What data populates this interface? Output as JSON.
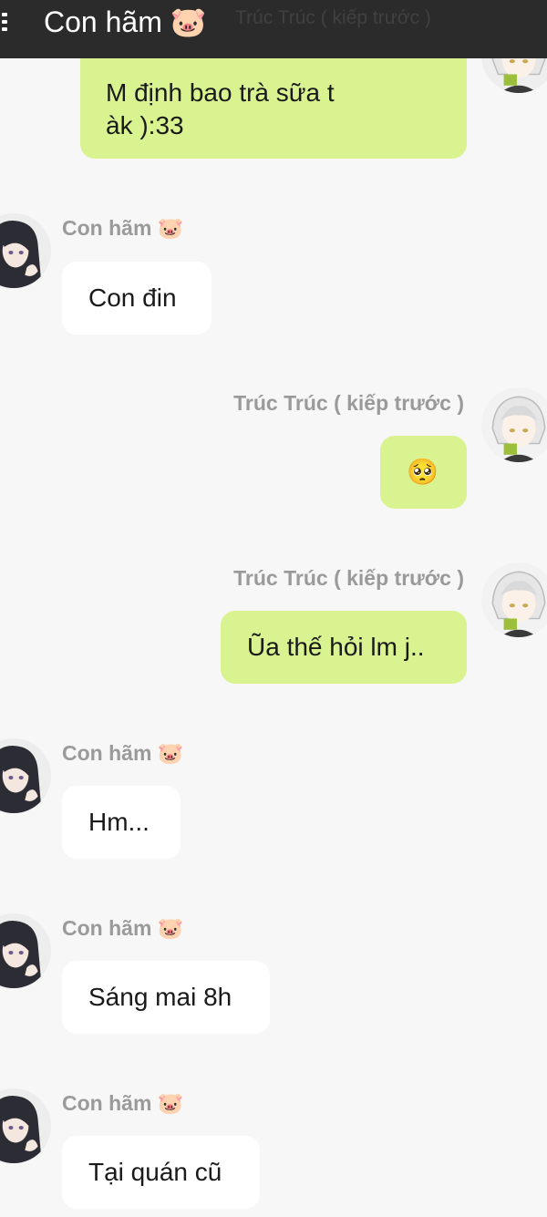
{
  "header": {
    "title": "Con hãm 🐷",
    "ghost_text": "Trúc Trúc ( kiếp trước )"
  },
  "messages": [
    {
      "side": "right",
      "sender": "",
      "text": "M định bao trà sữa t\nàk ):33"
    },
    {
      "side": "left",
      "sender": "Con hãm 🐷",
      "text": "Con đin"
    },
    {
      "side": "right",
      "sender": "Trúc Trúc ( kiếp trước )",
      "text": "🥺"
    },
    {
      "side": "right",
      "sender": "Trúc Trúc ( kiếp trước )",
      "text": "Ũa thế hỏi lm j.."
    },
    {
      "side": "left",
      "sender": "Con hãm 🐷",
      "text": "Hm..."
    },
    {
      "side": "left",
      "sender": "Con hãm 🐷",
      "text": "Sáng mai 8h"
    },
    {
      "side": "left",
      "sender": "Con hãm 🐷",
      "text": "Tại quán cũ"
    }
  ],
  "colors": {
    "header_bg": "#2b2b2b",
    "background": "#f7f7f7",
    "left_bubble": "#ffffff",
    "right_bubble": "#d8f390",
    "name_text": "#9a9a9a"
  },
  "icons": {
    "menu": "menu-icon",
    "left_avatar": "dark-haired-girl-avatar",
    "right_avatar": "white-haired-girl-avatar"
  }
}
